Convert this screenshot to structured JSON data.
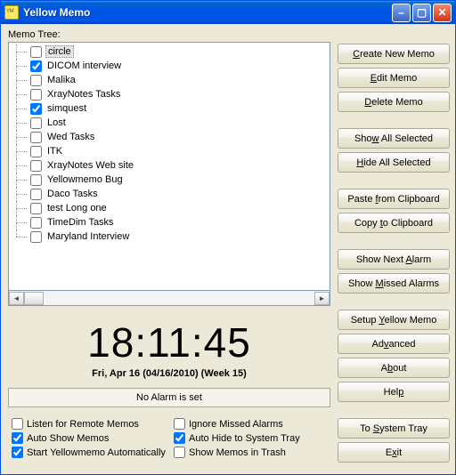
{
  "window": {
    "title": "Yellow Memo"
  },
  "tree": {
    "label": "Memo Tree:",
    "items": [
      {
        "label": "circle",
        "checked": false,
        "selected": true
      },
      {
        "label": "DICOM interview",
        "checked": true
      },
      {
        "label": "Malika",
        "checked": false
      },
      {
        "label": "XrayNotes Tasks",
        "checked": false
      },
      {
        "label": "simquest",
        "checked": true
      },
      {
        "label": "Lost",
        "checked": false
      },
      {
        "label": "Wed Tasks",
        "checked": false
      },
      {
        "label": "ITK",
        "checked": false
      },
      {
        "label": "XrayNotes Web site",
        "checked": false
      },
      {
        "label": "Yellowmemo Bug",
        "checked": false
      },
      {
        "label": "Daco Tasks",
        "checked": false
      },
      {
        "label": "test Long one",
        "checked": false
      },
      {
        "label": "TimeDim Tasks",
        "checked": false
      },
      {
        "label": "Maryland Interview",
        "checked": false
      }
    ]
  },
  "clock": {
    "time": "18:11:45",
    "date": "Fri, Apr 16 (04/16/2010) (Week 15)"
  },
  "alarm": {
    "status": "No Alarm is set"
  },
  "options": {
    "listen": {
      "label": "Listen for Remote Memos",
      "checked": false
    },
    "ignoremissed": {
      "label": "Ignore Missed Alarms",
      "checked": false
    },
    "autoshow": {
      "label": "Auto Show Memos",
      "checked": true
    },
    "autohide": {
      "label": "Auto Hide to System Tray",
      "checked": true
    },
    "autostart": {
      "label": "Start Yellowmemo Automatically",
      "checked": true
    },
    "showtrash": {
      "label": "Show Memos in Trash",
      "checked": false
    }
  },
  "buttons": {
    "create": {
      "pre": "",
      "mn": "C",
      "post": "reate New Memo"
    },
    "edit": {
      "pre": "",
      "mn": "E",
      "post": "dit Memo"
    },
    "delete": {
      "pre": "",
      "mn": "D",
      "post": "elete Memo"
    },
    "showall": {
      "pre": "Sho",
      "mn": "w",
      "post": " All Selected"
    },
    "hideall": {
      "pre": "",
      "mn": "H",
      "post": "ide All Selected"
    },
    "paste": {
      "pre": "Paste ",
      "mn": "f",
      "post": "rom Clipboard"
    },
    "copy": {
      "pre": "Copy ",
      "mn": "t",
      "post": "o Clipboard"
    },
    "nextalarm": {
      "pre": "Show Next ",
      "mn": "A",
      "post": "larm"
    },
    "missedalarm": {
      "pre": "Show ",
      "mn": "M",
      "post": "issed Alarms"
    },
    "setup": {
      "pre": "Setup ",
      "mn": "Y",
      "post": "ellow Memo"
    },
    "advanced": {
      "pre": "Ad",
      "mn": "v",
      "post": "anced"
    },
    "about": {
      "pre": "A",
      "mn": "b",
      "post": "out"
    },
    "help": {
      "pre": "Hel",
      "mn": "p",
      "post": ""
    },
    "tray": {
      "pre": "To ",
      "mn": "S",
      "post": "ystem Tray"
    },
    "exit": {
      "pre": "E",
      "mn": "x",
      "post": "it"
    }
  }
}
